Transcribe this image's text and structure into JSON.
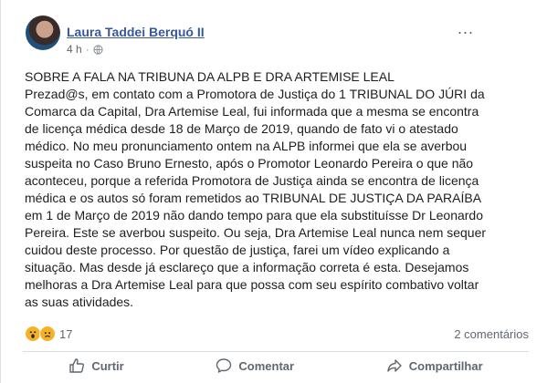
{
  "post": {
    "author": "Laura Taddei Berquó II",
    "time": "4 h",
    "audience_icon": "globe-icon",
    "more_label": "...",
    "paragraphs": [
      "SOBRE A FALA NA TRIBUNA DA ALPB E DRA ARTEMISE LEAL",
      "Prezad@s, em contato com a Promotora de Justiça do 1 TRIBUNAL DO JÚRI da Comarca da Capital, Dra Artemise Leal, fui informada que a mesma se encontra de licença médica desde 18 de Março de 2019, quando de fato vi o atestado médico. No meu pronunciamento ontem na ALPB informei que ela se averbou suspeita no Caso Bruno Ernesto, após o Promotor Leonardo Pereira o que não aconteceu, porque a referida Promotora de Justiça ainda se encontra de licença médica e os autos só foram remetidos ao TRIBUNAL DE JUSTIÇA DA PARAÍBA em 1 de Março de 2019 não dando tempo para que ela substituísse Dr Leonardo Pereira. Este se averbou suspeito. Ou seja, Dra Artemise Leal nunca nem sequer cuidou deste processo. Por questão de justiça, farei um vídeo explicando a situação. Mas desde já esclareço que a informação correta é esta. Desejamos melhoras a Dra Artemise Leal para que possa com seu espírito combativo voltar as suas atividades."
    ]
  },
  "reactions": {
    "count": "17",
    "types": [
      "wow-reaction-icon",
      "sad-reaction-icon"
    ]
  },
  "comments_label": "2 comentários",
  "actions": {
    "like": "Curtir",
    "comment": "Comentar",
    "share": "Compartilhar"
  },
  "colors": {
    "author_link": "#385898",
    "secondary_text": "#606770",
    "reaction_yellow": "#f7b125"
  }
}
